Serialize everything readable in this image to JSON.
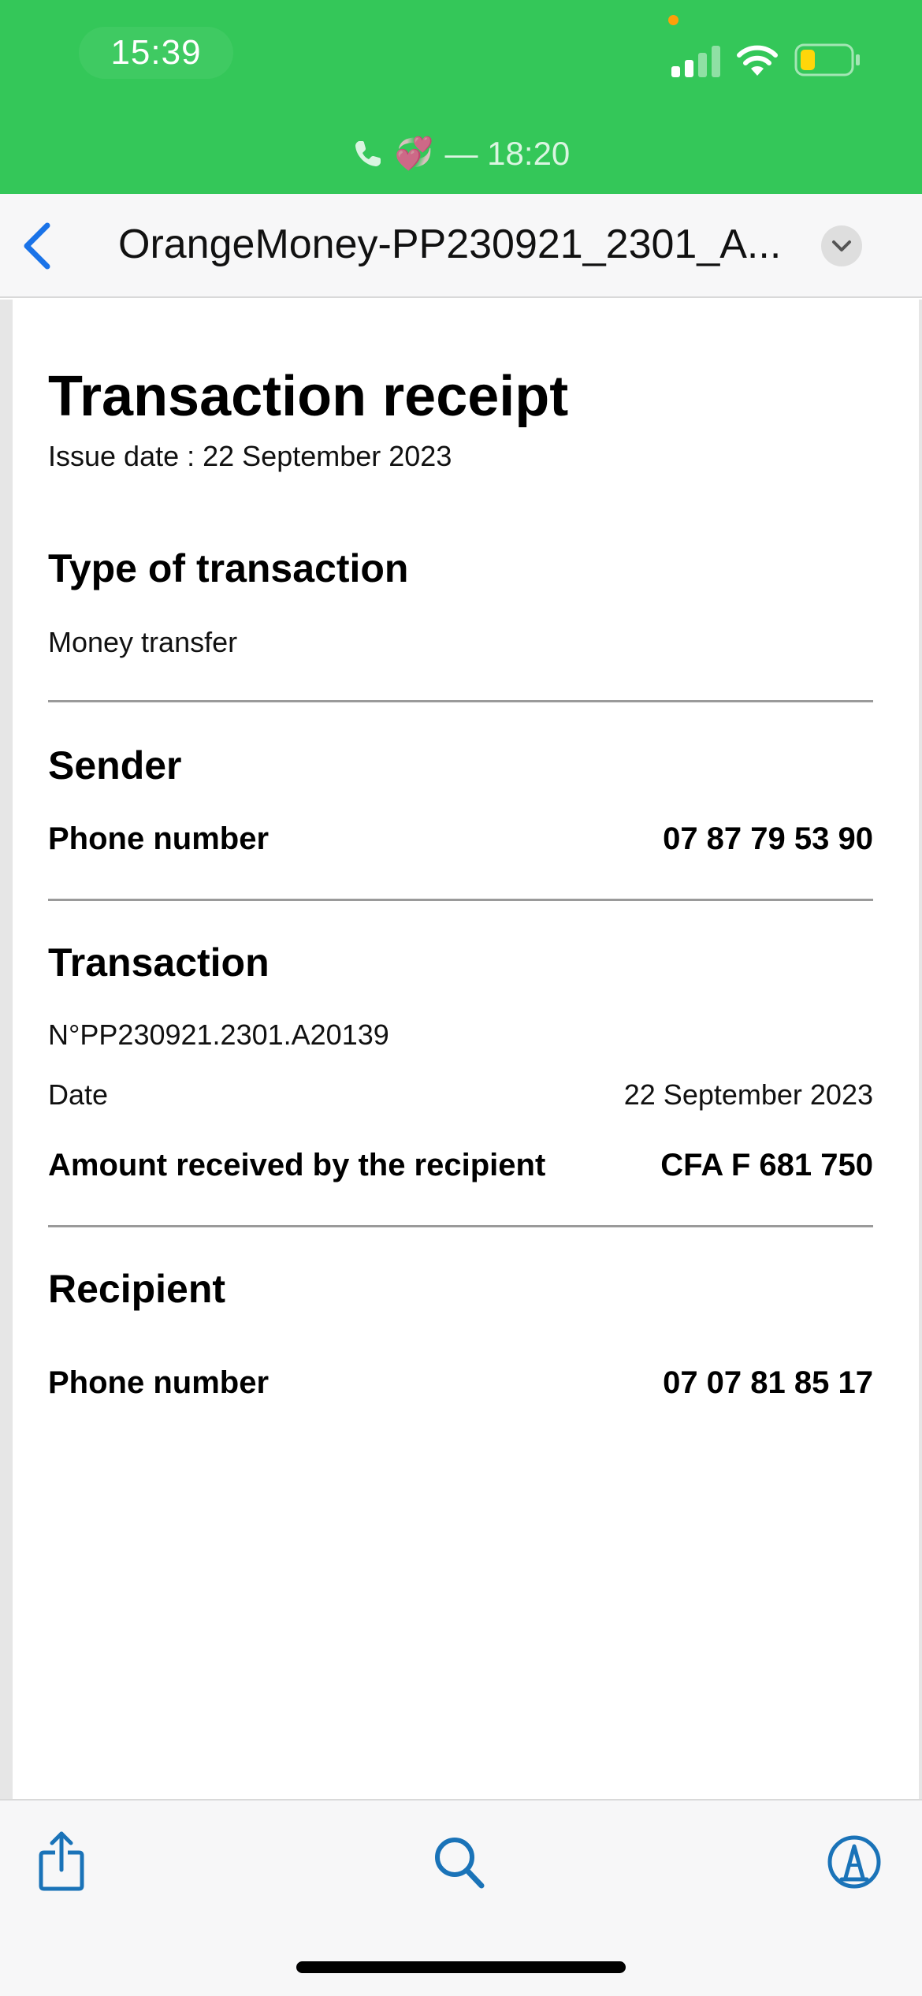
{
  "status_bar": {
    "time": "15:39",
    "call_banner": {
      "emoji": "💞",
      "duration_text": "— 18:20"
    },
    "icons": [
      "signal-icon",
      "wifi-icon",
      "battery-icon"
    ],
    "battery_level": 0.3,
    "colors": {
      "background": "#34c759",
      "battery_fill": "#ffd60a",
      "camera_dot": "#ff9f0a"
    }
  },
  "navbar": {
    "title": "OrangeMoney-PP230921_2301_A...",
    "icons": [
      "chevron-left-icon",
      "chevron-down-icon"
    ],
    "accent_color": "#1a73e8"
  },
  "receipt": {
    "title": "Transaction receipt",
    "issue_date": "Issue date : 22 September 2023",
    "type_section": {
      "heading": "Type of transaction",
      "value": "Money transfer"
    },
    "sender_section": {
      "heading": "Sender",
      "phone_label": "Phone number",
      "phone_value": "07 87 79 53 90"
    },
    "transaction_section": {
      "heading": "Transaction",
      "number": "N°PP230921.2301.A20139",
      "date_label": "Date",
      "date_value": "22 September 2023",
      "amount_label": "Amount received by the recipient",
      "amount_value": "CFA F 681 750"
    },
    "recipient_section": {
      "heading": "Recipient",
      "phone_label": "Phone number",
      "phone_value": "07 07 81 85 17"
    }
  },
  "toolbar": {
    "icons": [
      "share-icon",
      "search-icon",
      "markup-icon"
    ],
    "icon_color": "#1a73b8"
  }
}
